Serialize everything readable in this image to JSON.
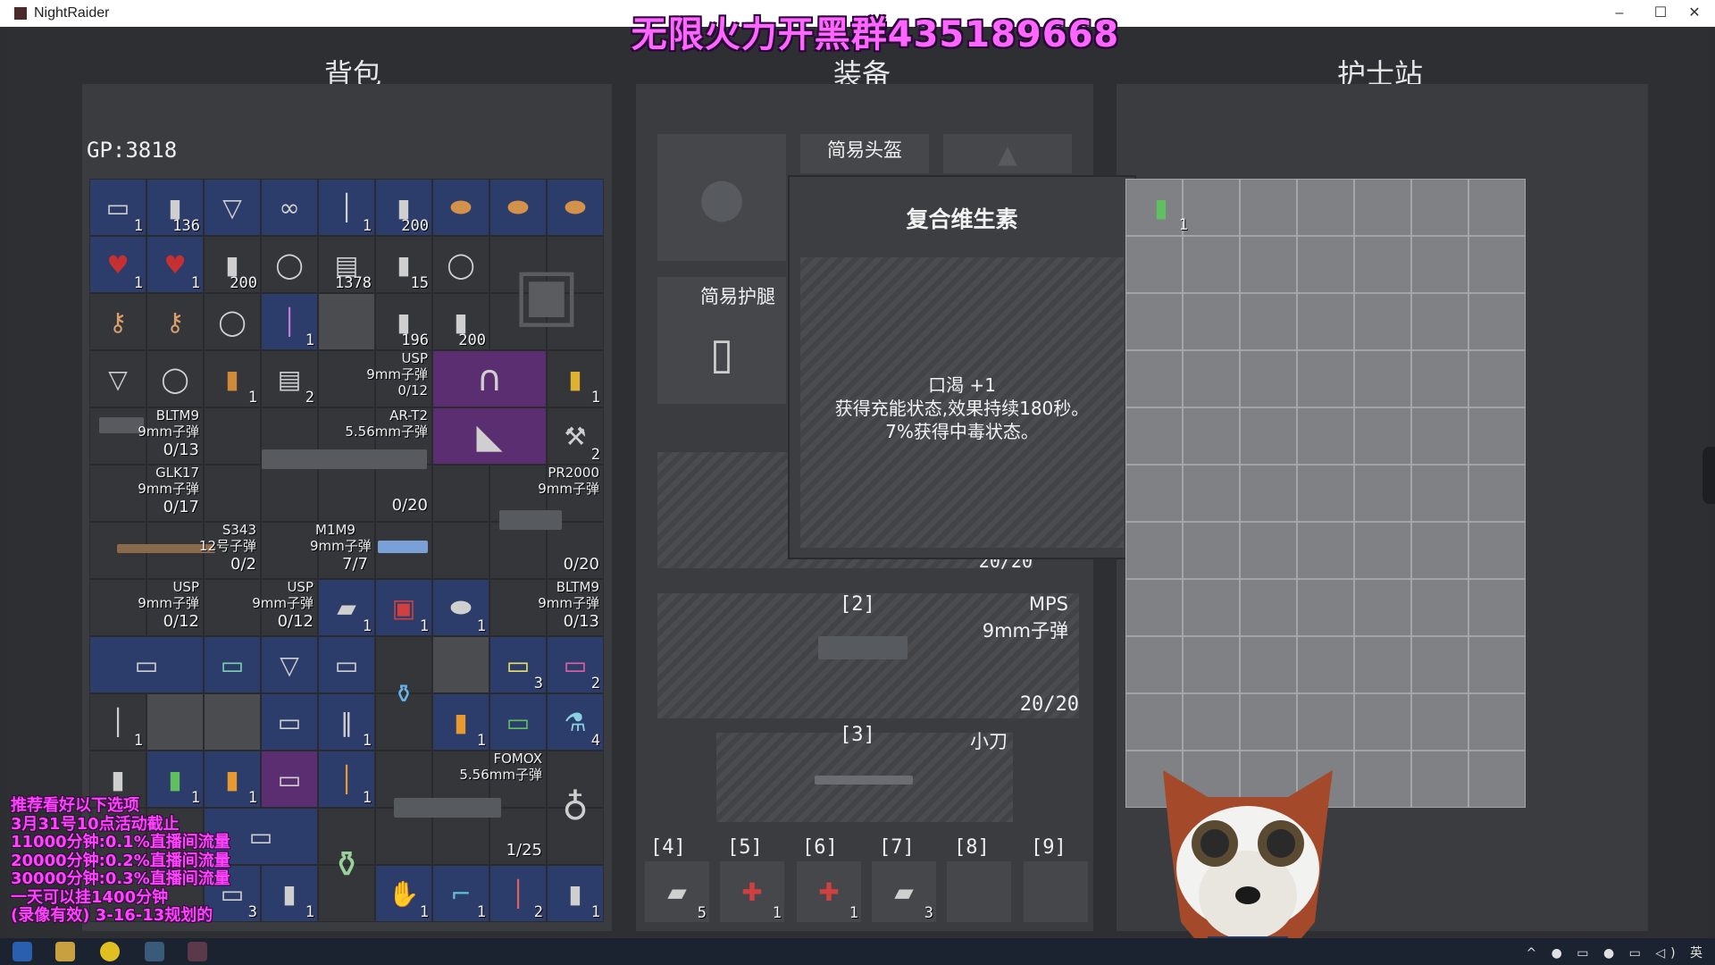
{
  "window": {
    "title": "NightRaider",
    "minimize": "–",
    "maximize": "☐",
    "close": "✕"
  },
  "banner": "无限火力开黑群435189668",
  "panels": {
    "backpack": "背包",
    "equipment": "装备",
    "nurse_station": "护士站"
  },
  "gp": "GP:3818",
  "backpack_counts": {
    "r0": [
      "1",
      "136",
      "",
      "",
      "1",
      "200"
    ],
    "r1": [
      "1",
      "1",
      "200",
      "",
      "1378",
      "15"
    ],
    "r2": [
      "",
      "",
      "",
      "1",
      "196",
      "200"
    ],
    "r3": [
      "",
      "",
      "1",
      "2",
      "1"
    ],
    "r9": [
      "1",
      "1",
      "1"
    ],
    "r10": [
      "3",
      "2"
    ],
    "r11": [
      "1",
      "1",
      "1",
      "4"
    ],
    "r12": [
      "1",
      "1",
      "1"
    ],
    "r13": [
      "3",
      "1",
      "1",
      "1",
      "2",
      "1"
    ]
  },
  "weapons": {
    "usp_1": {
      "name": "USP",
      "ammo": "9mm子弹",
      "mag": "0/12"
    },
    "ar_t2": {
      "name": "AR-T2",
      "ammo": "5.56mm子弹",
      "mag": "0/20"
    },
    "bltm9_1": {
      "name": "BLTM9",
      "ammo": "9mm子弹",
      "mag": "0/13"
    },
    "glk17": {
      "name": "GLK17",
      "ammo": "9mm子弹",
      "mag": "0/17"
    },
    "pr2000": {
      "name": "PR2000",
      "ammo": "9mm子弹",
      "mag": "0/20"
    },
    "s343": {
      "name": "S343",
      "ammo": "12号子弹",
      "mag": "0/2"
    },
    "m1m9": {
      "name": "M1M9",
      "ammo": "9mm子弹",
      "mag": "7/7"
    },
    "usp_2": {
      "name": "USP",
      "ammo": "9mm子弹",
      "mag": "0/12"
    },
    "usp_3": {
      "name": "USP",
      "ammo": "9mm子弹",
      "mag": "0/12"
    },
    "bltm9_2": {
      "name": "BLTM9",
      "ammo": "9mm子弹",
      "mag": "0/13"
    },
    "fomox": {
      "name": "FOMOX",
      "ammo": "5.56mm子弹",
      "mag": "1/25"
    }
  },
  "equipment": {
    "helmet": "简易头盔",
    "legs": "简易护腿",
    "slot1_mag": "20/20",
    "slot2": {
      "key": "[2]",
      "name": "MPS",
      "ammo": "9mm子弹",
      "mag": "20/20"
    },
    "slot3": {
      "key": "[3]",
      "name": "小刀"
    },
    "quick": [
      "[4]",
      "[5]",
      "[6]",
      "[7]",
      "[8]",
      "[9]"
    ],
    "quick_counts": [
      "5",
      "1",
      "1",
      "3",
      "",
      ""
    ]
  },
  "tooltip": {
    "title": "复合维生素",
    "lines": [
      "口渴 +1",
      "获得充能状态,效果持续180秒。",
      "7%获得中毒状态。"
    ]
  },
  "nurse": {
    "item_count": "1"
  },
  "promo_lines": [
    "推荐看好以下选项",
    "3月31号10点活动截止",
    "11000分钟:0.1%直播间流量",
    "20000分钟:0.2%直播间流量",
    "30000分钟:0.3%直播间流量",
    "一天可以挂1400分钟",
    "(录像有效) 3-16-13规划的"
  ],
  "tray": "^ ● ▭ ● ▭ ◁) 英",
  "colors": {
    "rare_blue": "#2c3d6b",
    "epic_purple": "#5a2e70",
    "banner_pink": "#ff66ff"
  }
}
